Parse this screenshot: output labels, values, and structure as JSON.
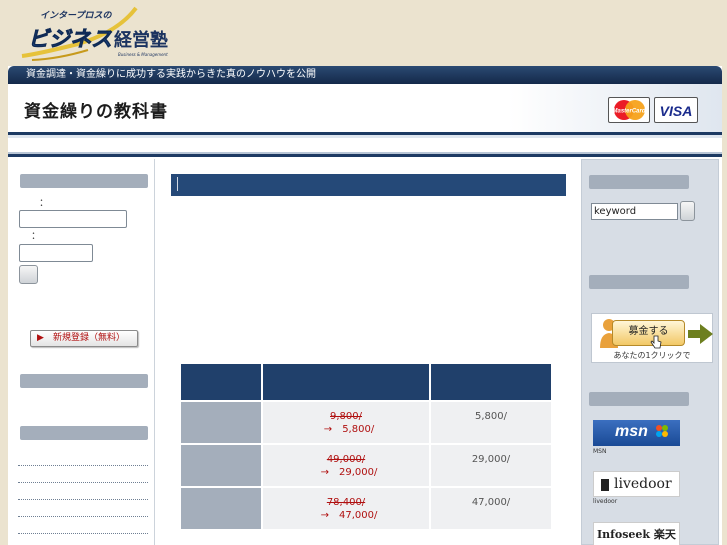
{
  "logo": {
    "top_text": "インタープロスの",
    "main_text": "ビジネス",
    "sub_text": "経営塾",
    "tiny_text": "Business & Management"
  },
  "header": {
    "tagline": "資金調達・資金繰りに成功する実践からきた真のノウハウを公開",
    "site_title": "資金繰りの教科書",
    "cards": {
      "mastercard": "MasterCard",
      "visa": "VISA"
    }
  },
  "login": {
    "id_colon": "：",
    "pw_colon": "：",
    "register_button": "新規登録（無料）",
    "register_arrow": "▶"
  },
  "pricing": {
    "rows": [
      {
        "old_price": "9,800/",
        "arrow": "→",
        "new_price": "5,800/",
        "price": "5,800/"
      },
      {
        "old_price": "49,000/",
        "arrow": "→",
        "new_price": "29,000/",
        "price": "29,000/"
      },
      {
        "old_price": "78,400/",
        "arrow": "→",
        "new_price": "47,000/",
        "price": "47,000/"
      }
    ]
  },
  "search": {
    "value": "keyword"
  },
  "recruit": {
    "button_label": "募金する",
    "caption": "あなたの1クリックで"
  },
  "banners": {
    "msn_label": "msn",
    "msn_caption": "MSN",
    "livedoor_label": "livedoor",
    "livedoor_caption": "livedoor",
    "infoseek_label": "Infoseek 楽天"
  },
  "colors": {
    "navy": "#20406b",
    "gray_header": "#a4aebb",
    "price_red": "#b01010",
    "page_bg": "#ebe3cf"
  }
}
